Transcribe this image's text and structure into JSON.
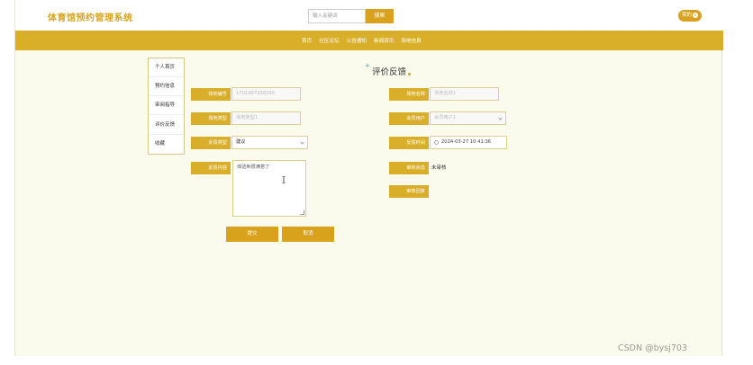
{
  "header": {
    "site_title": "体育馆预约管理系统",
    "search_placeholder": "输入关键词",
    "search_button": "搜索",
    "user_button": "我的"
  },
  "nav": {
    "items": [
      "首页",
      "社区论坛",
      "公告通知",
      "新闻资讯",
      "场地信息"
    ]
  },
  "sidebar": {
    "items": [
      "个人首页",
      "预约信息",
      "审阅指导",
      "评价反馈",
      "收藏"
    ]
  },
  "form": {
    "title": "评价反馈",
    "fields": {
      "venue_number": {
        "label": "场地编号",
        "placeholder": "1701967938290"
      },
      "venue_name": {
        "label": "场地名称",
        "placeholder": "场地名称1"
      },
      "venue_type": {
        "label": "场地类型",
        "placeholder": "场地类型1"
      },
      "member_account": {
        "label": "会员用户",
        "placeholder": "会员用户1"
      },
      "feedback_type": {
        "label": "反馈类型",
        "value": "建议"
      },
      "feedback_time": {
        "label": "反馈时间",
        "value": "2024-03-27 10:41:36"
      },
      "feedback_content": {
        "label": "反馈内容",
        "value": "体验到很满意了"
      },
      "review_status": {
        "label": "审核状态",
        "value": "未审核"
      },
      "review_reply": {
        "label": "审核回复"
      }
    },
    "submit_button": "提交",
    "cancel_button": "取消"
  },
  "watermark": "CSDN @bysj703",
  "colors": {
    "accent": "#d9a21c",
    "nav_bg": "#d9af2a",
    "content_bg": "#fbfbed"
  }
}
